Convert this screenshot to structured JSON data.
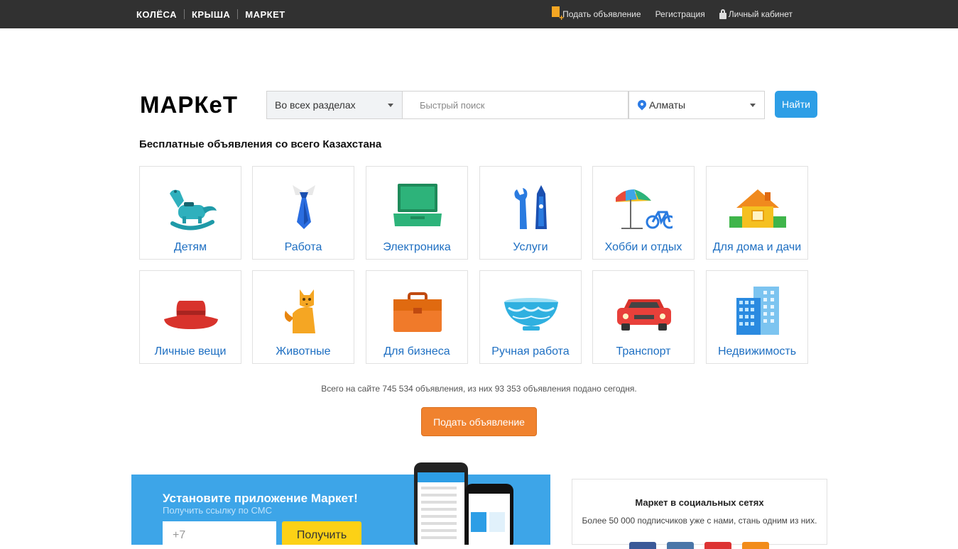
{
  "topbar": {
    "brands": [
      "КОЛЁСА",
      "КРЫША",
      "МАРКЕТ"
    ],
    "links": {
      "post_ad": "Подать объявление",
      "register": "Регистрация",
      "cabinet": "Личный кабинет"
    }
  },
  "search": {
    "logo": "МАРКeТ",
    "section_value": "Во всех разделах",
    "query_placeholder": "Быстрый поиск",
    "city_value": "Алматы",
    "button_label": "Найти"
  },
  "tagline": "Бесплатные объявления со всего Казахстана",
  "categories": [
    {
      "label": "Детям",
      "icon": "rocking-horse-icon"
    },
    {
      "label": "Работа",
      "icon": "necktie-icon"
    },
    {
      "label": "Электроника",
      "icon": "laptop-icon"
    },
    {
      "label": "Услуги",
      "icon": "tools-icon"
    },
    {
      "label": "Хобби и отдых",
      "icon": "umbrella-bicycle-icon"
    },
    {
      "label": "Для дома и дачи",
      "icon": "house-icon"
    },
    {
      "label": "Личные вещи",
      "icon": "hat-icon"
    },
    {
      "label": "Животные",
      "icon": "cat-icon"
    },
    {
      "label": "Для бизнеса",
      "icon": "briefcase-icon"
    },
    {
      "label": "Ручная работа",
      "icon": "bowl-icon"
    },
    {
      "label": "Транспорт",
      "icon": "car-icon"
    },
    {
      "label": "Недвижимость",
      "icon": "buildings-icon"
    }
  ],
  "stats_text": "Всего на сайте 745 534 объявления, из них 93 353 объявления подано сегодня.",
  "post_button": "Подать объявление",
  "app_banner": {
    "title": "Установите приложение Маркет!",
    "subtitle": "Получить ссылку по СМС",
    "phone_placeholder": "+7",
    "button": "Получить"
  },
  "social": {
    "title": "Маркет в социальных сетях",
    "subtitle": "Более 50 000 подписчиков уже с нами, стань одним из них."
  },
  "colors": {
    "topbar": "#313131",
    "link": "#1e6fc2",
    "find_button": "#2d9ee6",
    "post_button": "#f0822e",
    "banner": "#3da5e8",
    "get_button": "#fcd116"
  }
}
